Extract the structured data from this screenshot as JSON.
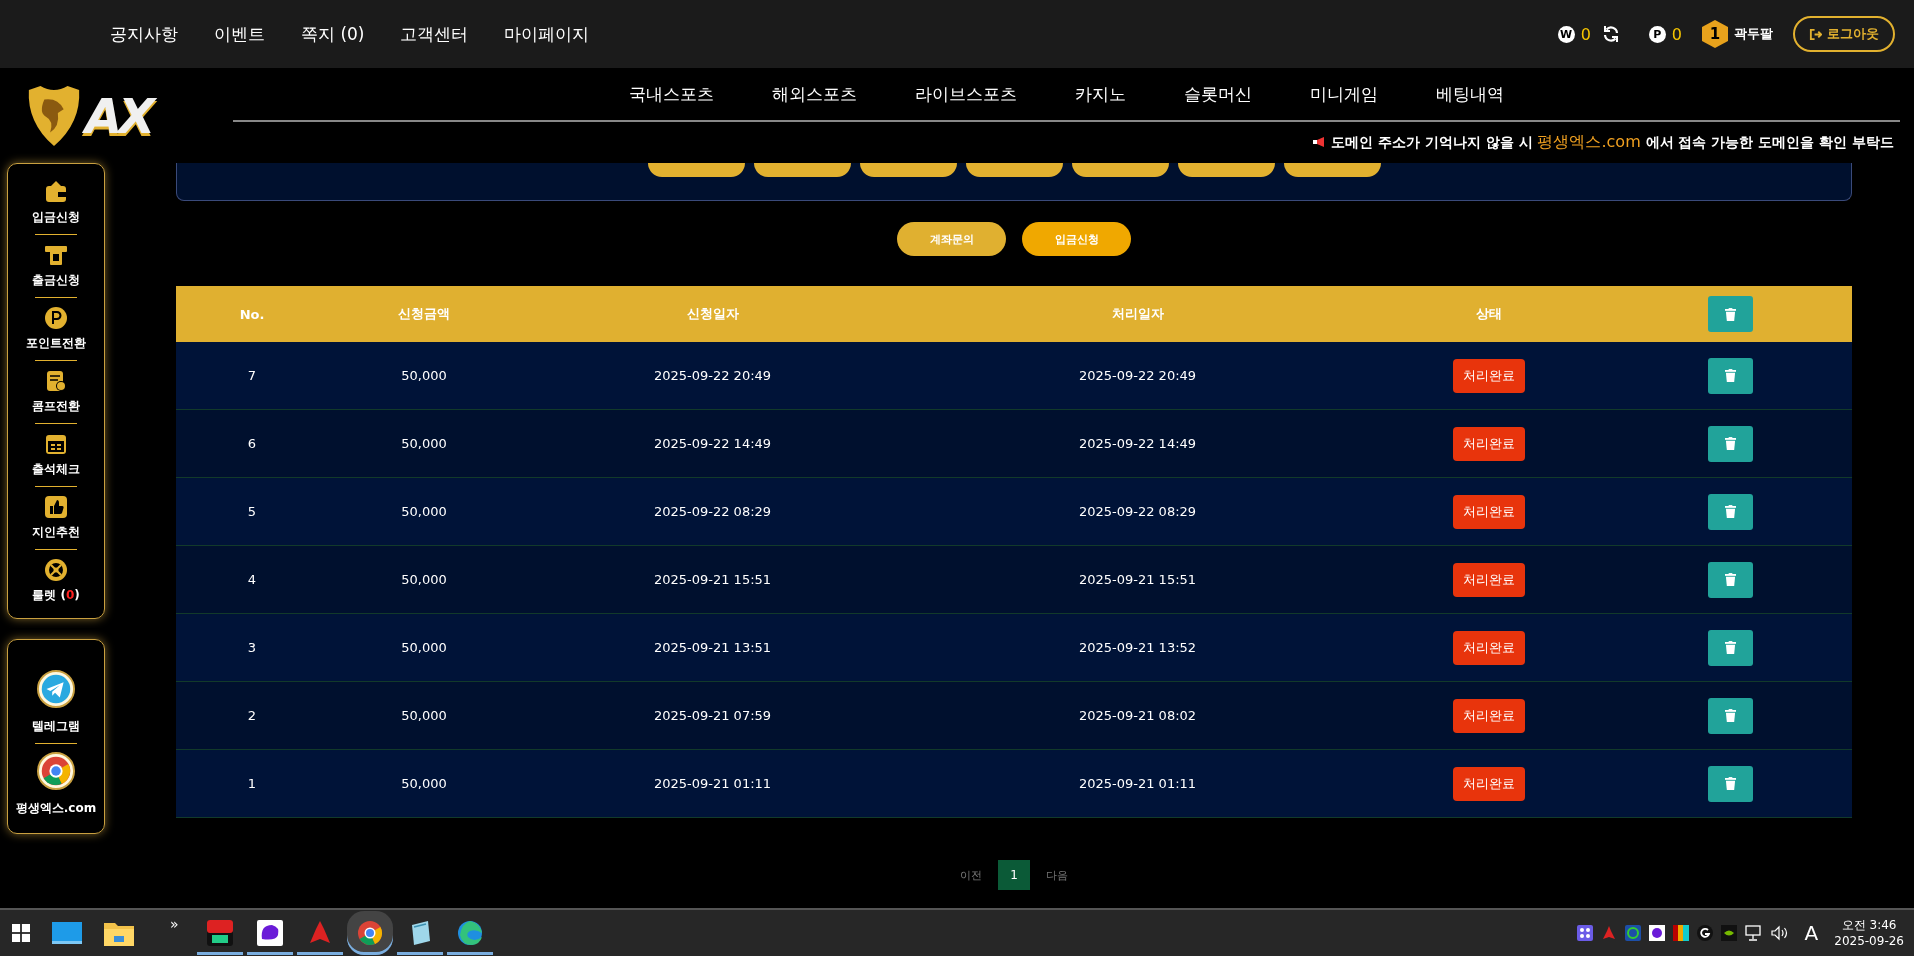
{
  "top_menu": [
    {
      "label": "공지사항"
    },
    {
      "label": "이벤트"
    },
    {
      "label": "쪽지 (0)"
    },
    {
      "label": "고객센터"
    },
    {
      "label": "마이페이지"
    }
  ],
  "account": {
    "cash_symbol": "W",
    "cash": "0",
    "point_symbol": "P",
    "points": "0",
    "level": "1",
    "username": "곽두팔",
    "logout": "로그아웃"
  },
  "logo": {
    "text": "AX"
  },
  "main_nav": [
    {
      "label": "국내스포츠"
    },
    {
      "label": "해외스포츠"
    },
    {
      "label": "라이브스포츠"
    },
    {
      "label": "카지노"
    },
    {
      "label": "슬롯머신"
    },
    {
      "label": "미니게임"
    },
    {
      "label": "베팅내역"
    }
  ],
  "ticker": {
    "before": "도메인 주소가 기억나지 않을 시 ",
    "highlight": "평생엑스.com",
    "after": " 에서 접속 가능한 도메인을 확인 부탁드"
  },
  "sidebar": [
    {
      "kind": "wallet",
      "label": "입금신청"
    },
    {
      "kind": "atm",
      "label": "출금신청"
    },
    {
      "kind": "point",
      "label": "포인트전환"
    },
    {
      "kind": "comp",
      "label": "콤프전환"
    },
    {
      "kind": "calendar",
      "label": "출석체크"
    },
    {
      "kind": "thumb",
      "label": "지인추천"
    },
    {
      "kind": "roulette",
      "label": "룰렛",
      "count_prefix": " (",
      "count": "0",
      "count_suffix": ")"
    }
  ],
  "sidebar_links": [
    {
      "kind": "telegram",
      "label": "텔레그램"
    },
    {
      "kind": "chrome",
      "label": "평생엑스.com"
    }
  ],
  "top_panel": {
    "buttons": [
      {
        "kind": "pill"
      },
      {
        "kind": "pill"
      },
      {
        "kind": "pill"
      },
      {
        "kind": "pill"
      },
      {
        "kind": "pill"
      },
      {
        "kind": "pill"
      },
      {
        "kind": "pill"
      }
    ]
  },
  "actions": [
    {
      "label": "계좌문의",
      "selected": false
    },
    {
      "label": "입금신청",
      "selected": true
    }
  ],
  "table": {
    "columns": [
      "No.",
      "신청금액",
      "신청일자",
      "처리일자",
      "상태"
    ],
    "rows": [
      {
        "no": "7",
        "amount": "50,000",
        "requested": "2025-09-22 20:49",
        "processed": "2025-09-22 20:49",
        "status": "처리완료"
      },
      {
        "no": "6",
        "amount": "50,000",
        "requested": "2025-09-22 14:49",
        "processed": "2025-09-22 14:49",
        "status": "처리완료"
      },
      {
        "no": "5",
        "amount": "50,000",
        "requested": "2025-09-22 08:29",
        "processed": "2025-09-22 08:29",
        "status": "처리완료"
      },
      {
        "no": "4",
        "amount": "50,000",
        "requested": "2025-09-21 15:51",
        "processed": "2025-09-21 15:51",
        "status": "처리완료"
      },
      {
        "no": "3",
        "amount": "50,000",
        "requested": "2025-09-21 13:51",
        "processed": "2025-09-21 13:52",
        "status": "처리완료"
      },
      {
        "no": "2",
        "amount": "50,000",
        "requested": "2025-09-21 07:59",
        "processed": "2025-09-21 08:02",
        "status": "처리완료"
      },
      {
        "no": "1",
        "amount": "50,000",
        "requested": "2025-09-21 01:11",
        "processed": "2025-09-21 01:11",
        "status": "처리완료"
      }
    ]
  },
  "pagination": {
    "prev": "이전",
    "pages": [
      {
        "label": "1",
        "selected": true
      }
    ],
    "next": "다음"
  },
  "taskbar": {
    "overflow": "»",
    "apps": [
      {
        "kind": "tv",
        "active": false
      },
      {
        "kind": "blob",
        "active": false
      },
      {
        "kind": "flame",
        "active": false
      },
      {
        "kind": "chrome",
        "active": true
      },
      {
        "kind": "notepad",
        "active": false
      },
      {
        "kind": "edge",
        "active": false
      }
    ],
    "tray": [
      {
        "kind": "grid"
      },
      {
        "kind": "red"
      },
      {
        "kind": "chat"
      },
      {
        "kind": "purple"
      },
      {
        "kind": "bars"
      },
      {
        "kind": "g"
      },
      {
        "kind": "nvidia"
      }
    ],
    "ime": "A",
    "time": "오전 3:46",
    "date": "2025-09-26"
  }
}
